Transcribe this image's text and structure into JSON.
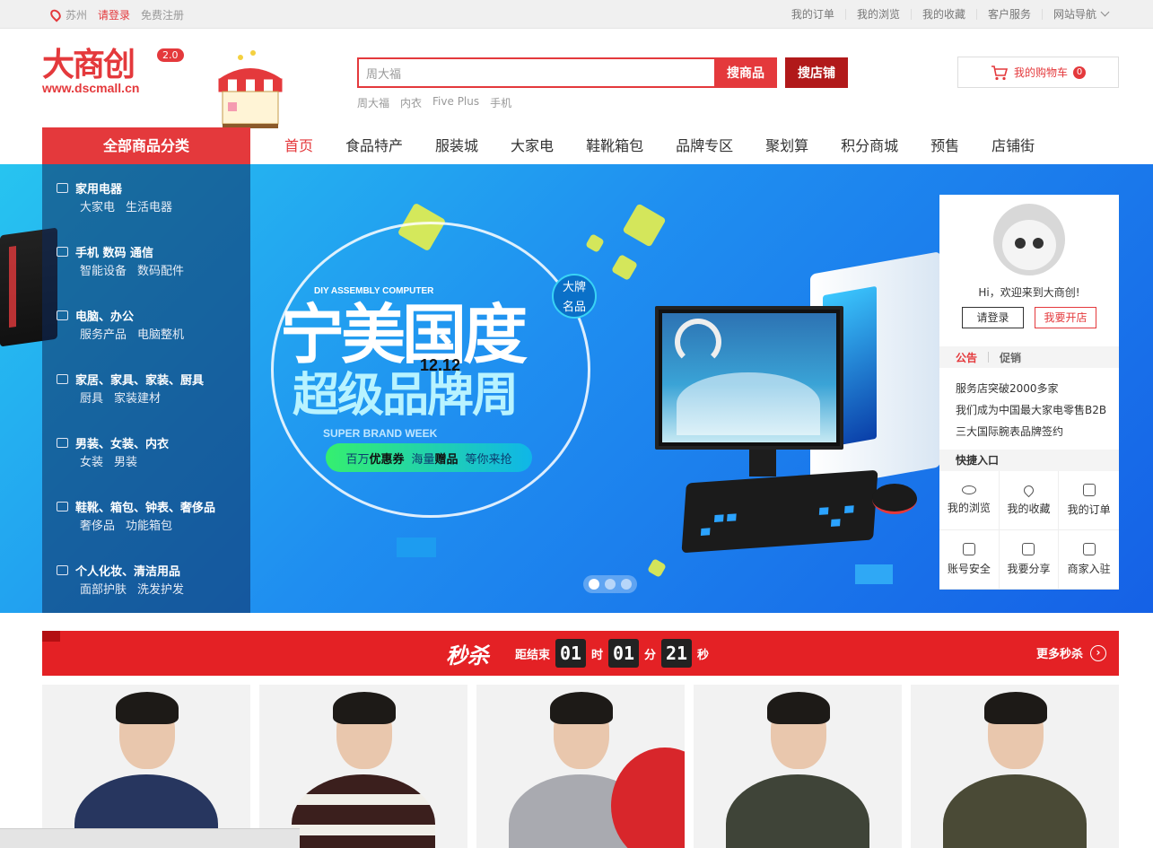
{
  "topbar": {
    "city": "苏州",
    "login": "请登录",
    "register": "免费注册",
    "links": [
      "我的订单",
      "我的浏览",
      "我的收藏",
      "客户服务",
      "网站导航"
    ]
  },
  "logo": {
    "name": "大商创",
    "version": "2.0",
    "url": "www.dscmall.cn"
  },
  "search": {
    "value": "周大福",
    "btn_goods": "搜商品",
    "btn_shop": "搜店铺",
    "hotwords": [
      "周大福",
      "内衣",
      "Five Plus",
      "手机"
    ]
  },
  "cart": {
    "label": "我的购物车",
    "count": "0"
  },
  "nav": {
    "all_categories": "全部商品分类",
    "items": [
      "首页",
      "食品特产",
      "服装城",
      "大家电",
      "鞋靴箱包",
      "品牌专区",
      "聚划算",
      "积分商城",
      "预售",
      "店铺街"
    ]
  },
  "categories": [
    {
      "title": "家用电器",
      "subs": [
        "大家电",
        "生活电器"
      ]
    },
    {
      "title": "手机  数码  通信",
      "subs": [
        "智能设备",
        "数码配件"
      ]
    },
    {
      "title": "电脑、办公",
      "subs": [
        "服务产品",
        "电脑整机"
      ]
    },
    {
      "title": "家居、家具、家装、厨具",
      "subs": [
        "厨具",
        "家装建材"
      ]
    },
    {
      "title": "男装、女装、内衣",
      "subs": [
        "女装",
        "男装"
      ]
    },
    {
      "title": "鞋靴、箱包、钟表、奢侈品",
      "subs": [
        "奢侈品",
        "功能箱包"
      ]
    },
    {
      "title": "个人化妆、清洁用品",
      "subs": [
        "面部护肤",
        "洗发护发"
      ]
    }
  ],
  "banner": {
    "en_title": "DIY ASSEMBLY COMPUTER",
    "headline": "宁美国度",
    "subline": "超级品牌周",
    "date": "12.12",
    "en_sub": "SUPER BRAND WEEK",
    "badge_line1": "大牌",
    "badge_line2": "名品",
    "pill_prefix": "百万",
    "pill_bold1": "优惠券",
    "pill_mid": "海量",
    "pill_bold2": "赠品",
    "pill_suffix": "等你来抢"
  },
  "user_panel": {
    "greeting": "Hi，欢迎来到大商创!",
    "login": "请登录",
    "open_shop": "我要开店",
    "tabs": [
      "公告",
      "促销"
    ],
    "notices": [
      "服务店突破2000多家",
      "我们成为中国最大家电零售B2B",
      "三大国际腕表品牌签约"
    ],
    "quick_title": "快捷入口",
    "quick": [
      {
        "label": "我的浏览",
        "icon": "eye-icon"
      },
      {
        "label": "我的收藏",
        "icon": "heart-icon"
      },
      {
        "label": "我的订单",
        "icon": "order-icon"
      },
      {
        "label": "账号安全",
        "icon": "lock-icon"
      },
      {
        "label": "我要分享",
        "icon": "share-icon"
      },
      {
        "label": "商家入驻",
        "icon": "store-icon"
      }
    ]
  },
  "seckill": {
    "title": "秒杀",
    "end_label": "距结束",
    "hours": "01",
    "h_unit": "时",
    "minutes": "01",
    "m_unit": "分",
    "seconds": "21",
    "s_unit": "秒",
    "more": "更多秒杀"
  },
  "colors": {
    "brand": "#e4393c",
    "seckill_bg": "#e42125",
    "shop_btn": "#b1191a"
  }
}
